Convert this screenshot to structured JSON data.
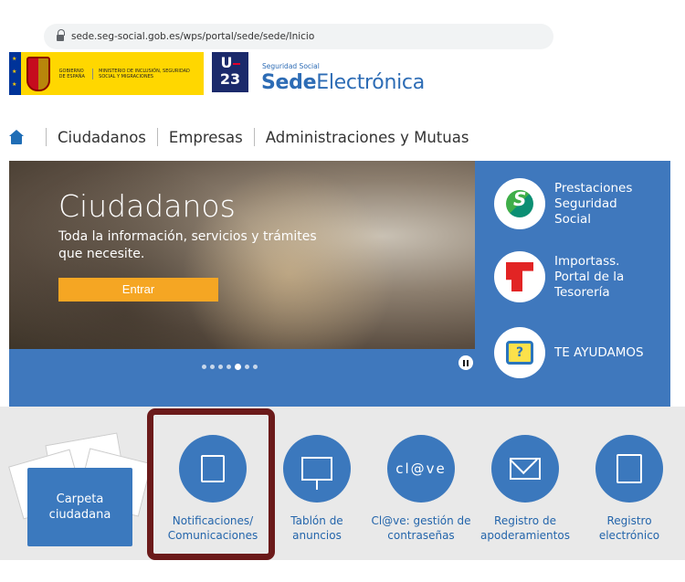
{
  "browser": {
    "url": "sede.seg-social.gob.es/wps/portal/sede/sede/Inicio"
  },
  "header": {
    "gov_line1": "GOBIERNO DE ESPAÑA",
    "gov_line2": "MINISTERIO DE INCLUSIÓN, SEGURIDAD SOCIAL Y MIGRACIONES",
    "ue_badge": "UE 23",
    "brand_small": "Seguridad Social",
    "brand_bold": "Sede",
    "brand_light": "Electrónica"
  },
  "nav": {
    "items": [
      "Ciudadanos",
      "Empresas",
      "Administraciones y Mutuas"
    ]
  },
  "hero": {
    "title": "Ciudadanos",
    "subtitle": "Toda la información, servicios y trámites que necesite.",
    "button": "Entrar",
    "carousel_slide_count": 7,
    "carousel_active_index": 4
  },
  "side": [
    {
      "label": "Prestaciones Seguridad Social",
      "icon": "prestaciones-icon"
    },
    {
      "label": "Importass. Portal de la Tesorería",
      "icon": "importass-icon"
    },
    {
      "label": "TE AYUDAMOS",
      "icon": "help-icon"
    }
  ],
  "services": {
    "carpeta": "Carpeta ciudadana",
    "items": [
      {
        "label": "Notificaciones/ Comunicaciones"
      },
      {
        "label": "Tablón de anuncios"
      },
      {
        "label": "Cl@ve: gestión de contraseñas",
        "icon_text": "cl@ve"
      },
      {
        "label": "Registro de apoderamientos"
      },
      {
        "label": "Registro electrónico"
      }
    ]
  },
  "colors": {
    "primary": "#3f78bd",
    "accent": "#f5a623",
    "highlight": "#6b1a1a"
  }
}
